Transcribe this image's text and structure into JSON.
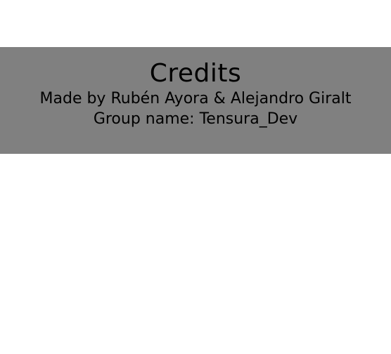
{
  "credits": {
    "title": "Credits",
    "made_by": "Made by Rubén Ayora & Alejandro Giralt",
    "group_name": "Group name: Tensura_Dev"
  },
  "colors": {
    "background": "#ffffff",
    "panel": "#808080",
    "text": "#000000"
  }
}
